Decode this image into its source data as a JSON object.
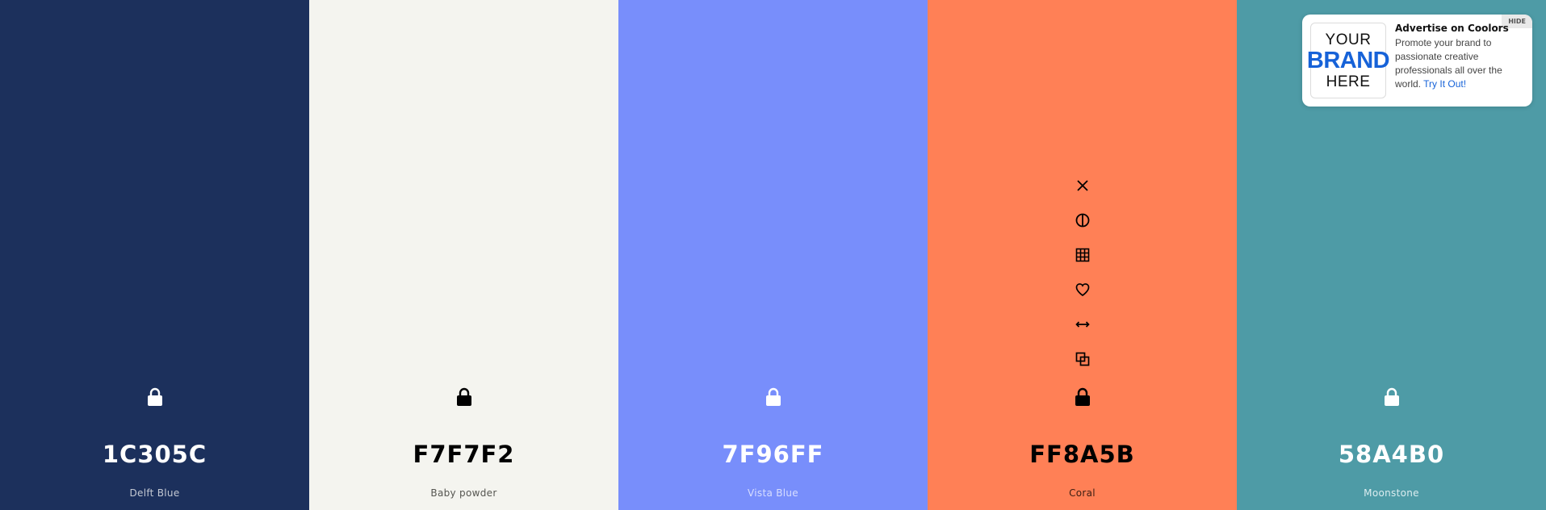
{
  "colors": [
    {
      "hex": "1C305C",
      "name": "Delft Blue",
      "bg": "#1C305C",
      "text_color": "#FFFFFF",
      "name_color": "#C4C9D3",
      "icon_color": "#FFFFFF"
    },
    {
      "hex": "F7F7F2",
      "name": "Baby powder",
      "bg": "#F4F4EF",
      "text_color": "#000000",
      "name_color": "#555550",
      "icon_color": "#000000"
    },
    {
      "hex": "7F96FF",
      "name": "Vista Blue",
      "bg": "#788EFB",
      "text_color": "#FFFFFF",
      "name_color": "#D8DEFF",
      "icon_color": "#FFFFFF"
    },
    {
      "hex": "FF8A5B",
      "name": "Coral",
      "bg": "#FF8056",
      "text_color": "#000000",
      "name_color": "#3A1D12",
      "icon_color": "#000000"
    },
    {
      "hex": "58A4B0",
      "name": "Moonstone",
      "bg": "#4E9BA6",
      "text_color": "#FFFFFF",
      "name_color": "#DCEDF0",
      "icon_color": "#FFFFFF"
    }
  ],
  "hovered_swatch_tools": [
    "remove-icon",
    "shades-icon",
    "grid-icon",
    "favorite-heart-icon",
    "drag-arrows-icon",
    "copy-icon"
  ],
  "ad": {
    "hide_label": "HIDE",
    "logo_line1": "YOUR",
    "logo_line2": "BRAND",
    "logo_line3": "HERE",
    "title": "Advertise on Coolors",
    "body": "Promote your brand to passionate creative professionals all over the world.",
    "link_text": "Try It Out!"
  }
}
